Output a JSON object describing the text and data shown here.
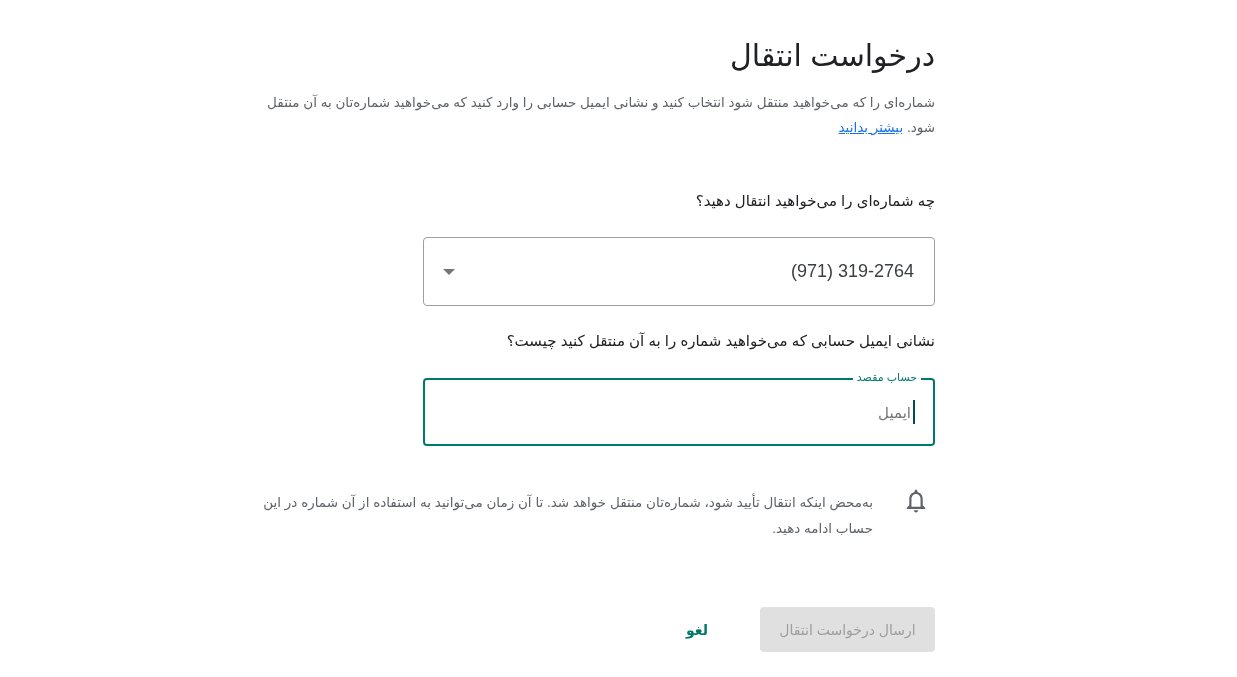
{
  "title": "درخواست انتقال",
  "description": {
    "text": "شماره‌ای را که می‌خواهید منتقل شود انتخاب کنید و نشانی ایمیل حسابی را وارد کنید که می‌خواهید شماره‌تان به آن منتقل شود.",
    "link": "بیشتر بدانید"
  },
  "number_question": "چه شماره‌ای را می‌خواهید انتقال دهید؟",
  "number_select": {
    "value": "(971) 319-2764"
  },
  "email_question": "نشانی ایمیل حسابی که می‌خواهید شماره را به آن منتقل کنید چیست؟",
  "email_field": {
    "label": "حساب مقصد",
    "placeholder": "ایمیل",
    "focused": true
  },
  "notice": {
    "text": "به‌محض اینکه انتقال تأیید شود، شماره‌تان منتقل خواهد شد. تا آن زمان می‌توانید به استفاده از آن شماره در این حساب ادامه دهید."
  },
  "buttons": [
    {
      "label": "ارسال درخواست انتقال",
      "kind": "primary",
      "disabled": true
    },
    {
      "label": "لغو",
      "kind": "text",
      "disabled": false
    }
  ]
}
